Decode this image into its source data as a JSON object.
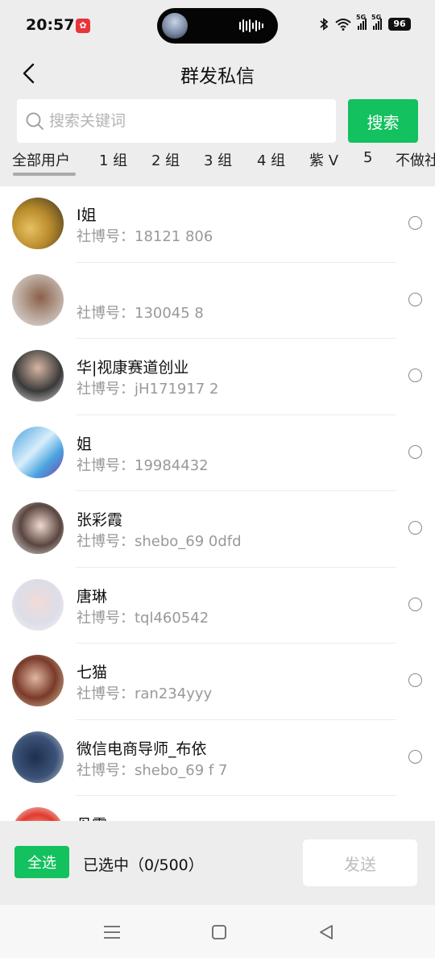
{
  "status_bar": {
    "time": "20:57",
    "app_badge": "✿",
    "network_1": "5G",
    "network_2": "5G",
    "battery": "96"
  },
  "title_bar": {
    "title": "群发私信"
  },
  "search": {
    "placeholder": "搜索关键词",
    "value": "",
    "button_label": "搜索"
  },
  "tabs": [
    {
      "label": "全部用户"
    },
    {
      "label": "1 组"
    },
    {
      "label": "2 组"
    },
    {
      "label": "3 组"
    },
    {
      "label": "4 组"
    },
    {
      "label": "紫 V"
    },
    {
      "label": "5"
    },
    {
      "label": "不做社"
    }
  ],
  "users": [
    {
      "name": "I姐",
      "id": "社博号：18121  806"
    },
    {
      "name": "",
      "id": "社博号：130045  8"
    },
    {
      "name": "华|视康赛道创业",
      "id": "社博号：jH171917  2"
    },
    {
      "name": "姐",
      "id": "社博号：19984432"
    },
    {
      "name": "张彩霞",
      "id": "社博号：shebo_69  0dfd"
    },
    {
      "name": "唐琳",
      "id": "社博号：tql460542"
    },
    {
      "name": "七猫",
      "id": "社博号：ran234yyy"
    },
    {
      "name": "微信电商导师_布依",
      "id": "社博号：shebo_69  f  7"
    },
    {
      "name": "丹霞",
      "id": ""
    }
  ],
  "action_bar": {
    "select_all_label": "全选",
    "selected_text": "已选中（0/500）",
    "send_label": "发送"
  },
  "colors": {
    "accent": "#13c15e",
    "background": "#ededed"
  }
}
